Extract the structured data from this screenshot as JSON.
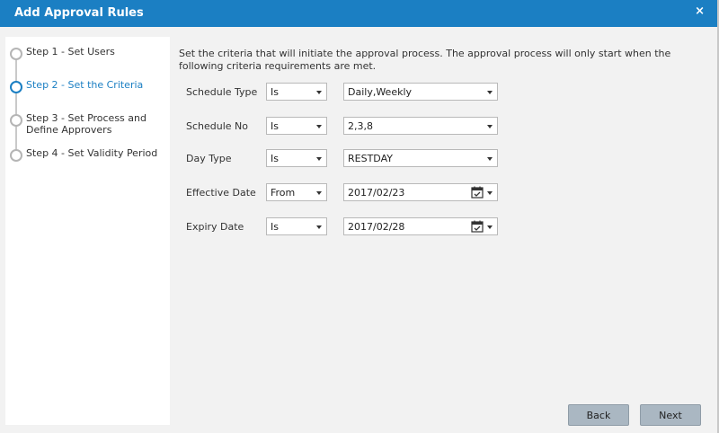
{
  "dialog": {
    "title": "Add Approval Rules",
    "close_label": "×"
  },
  "steps": [
    {
      "label": "Step 1 - Set Users",
      "active": false
    },
    {
      "label": "Step 2 - Set the Criteria",
      "active": true
    },
    {
      "label": "Step 3 - Set Process and Define Approvers",
      "active": false
    },
    {
      "label": "Step 4 - Set Validity Period",
      "active": false
    }
  ],
  "intro": "Set the criteria that will initiate the approval process. The approval process will only start when the following criteria requirements are met.",
  "criteria": [
    {
      "label": "Schedule Type",
      "operator": "Is",
      "value": "Daily,Weekly",
      "calendar": false
    },
    {
      "label": "Schedule No",
      "operator": "Is",
      "value": "2,3,8",
      "calendar": false
    },
    {
      "label": "Day Type",
      "operator": "Is",
      "value": "RESTDAY",
      "calendar": false
    },
    {
      "label": "Effective Date",
      "operator": "From",
      "value": "2017/02/23",
      "calendar": true
    },
    {
      "label": "Expiry Date",
      "operator": "Is",
      "value": "2017/02/28",
      "calendar": true
    }
  ],
  "buttons": {
    "back": "Back",
    "next": "Next"
  },
  "colors": {
    "header": "#1b7fc3",
    "active_step": "#1b7fc3",
    "button": "#aab7c2"
  },
  "icons": {
    "calendar": "calendar-icon",
    "dropdown": "chevron-down-icon",
    "close": "close-icon"
  }
}
